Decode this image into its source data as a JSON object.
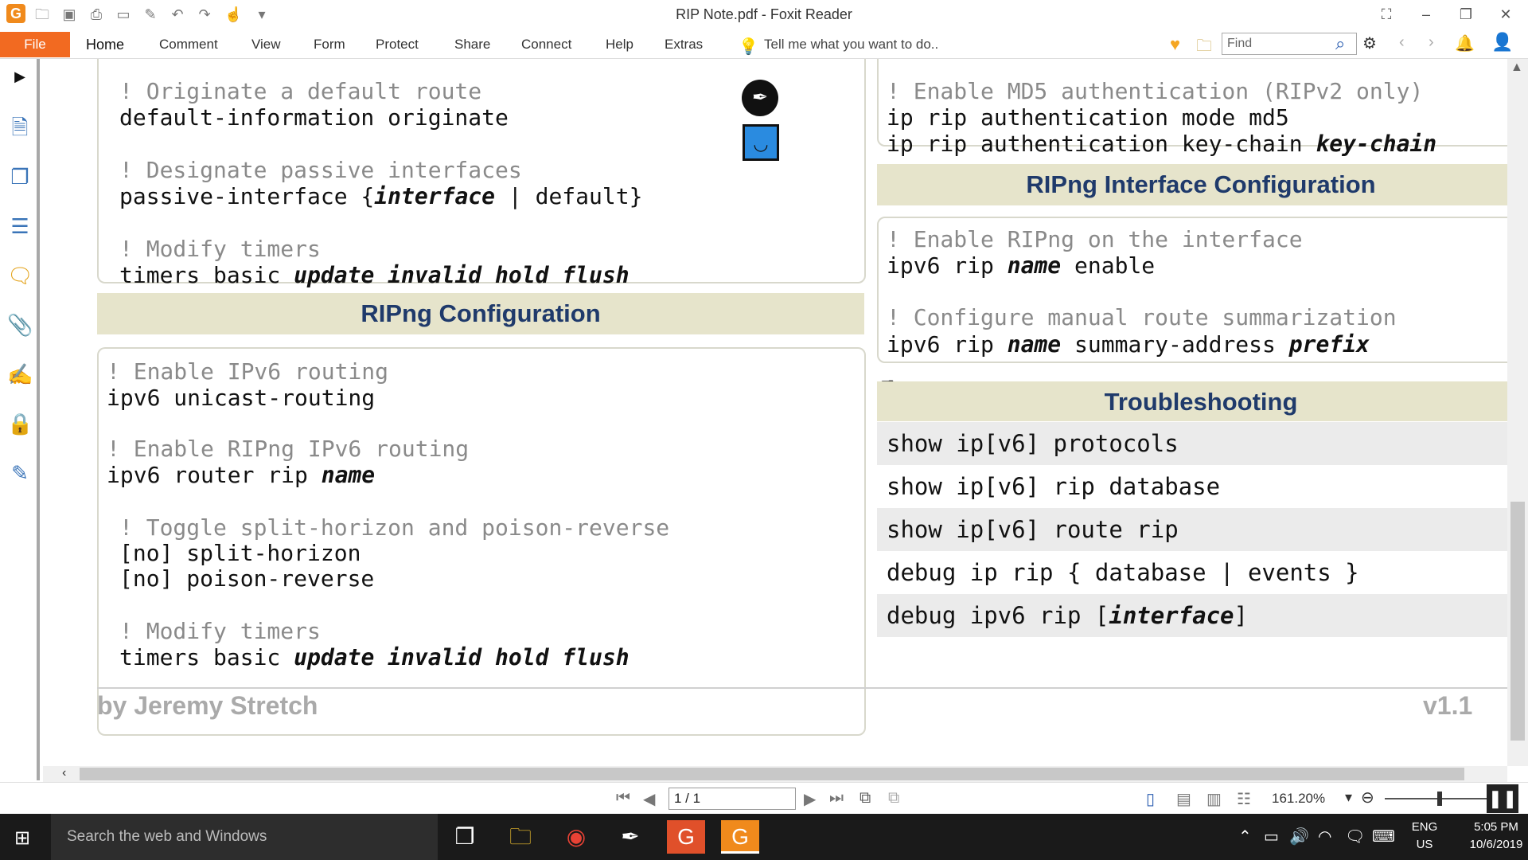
{
  "window": {
    "title": "RIP Note.pdf - Foxit Reader",
    "logo": "G"
  },
  "ribbon": {
    "file": "File",
    "tabs": [
      "Home",
      "Comment",
      "View",
      "Form",
      "Protect",
      "Share",
      "Connect",
      "Help",
      "Extras"
    ],
    "tell_me": "Tell me what you want to do..",
    "find_placeholder": "Find"
  },
  "doc": {
    "left_top": {
      "c1": "! Originate a default route",
      "l1": "default-information originate",
      "c2": "! Designate passive interfaces",
      "l2a": "passive-interface {",
      "l2b": "interface",
      "l2c": " | default}",
      "c3": "! Modify timers",
      "l3a": "timers basic ",
      "l3b": "update invalid hold flush"
    },
    "right_top": {
      "c1": "! Enable MD5 authentication (RIPv2 only)",
      "l1": "ip rip authentication mode md5",
      "l2a": "ip rip authentication key-chain ",
      "l2b": "key-chain"
    },
    "ripng_config": {
      "header": "RIPng Configuration",
      "c1": "! Enable IPv6 routing",
      "l1": "ipv6 unicast-routing",
      "c2": "! Enable RIPng IPv6 routing",
      "l2a": "ipv6 router rip ",
      "l2b": "name",
      "c3": "! Toggle split-horizon and poison-reverse",
      "l3": "[no] split-horizon",
      "l4": "[no] poison-reverse",
      "c4": "! Modify timers",
      "l5a": "timers basic ",
      "l5b": "update invalid hold flush"
    },
    "ripng_iface": {
      "header": "RIPng Interface Configuration",
      "c1": "! Enable RIPng on the interface",
      "l1a": "ipv6 rip ",
      "l1b": "name",
      "l1c": " enable",
      "c2": "! Configure manual route summarization",
      "l2a": "ipv6 rip ",
      "l2b": "name",
      "l2c": " summary-address ",
      "l2d": "prefix"
    },
    "troubleshooting": {
      "header": "Troubleshooting",
      "r1": "show ip[v6] protocols",
      "r2": "show ip[v6] rip database",
      "r3": "show ip[v6] route rip",
      "r4": "debug ip rip { database | events }",
      "r5a": "debug ipv6 rip [",
      "r5b": "interface",
      "r5c": "]"
    },
    "author": "by Jeremy Stretch",
    "version": "v1.1"
  },
  "status": {
    "page": "1 / 1",
    "zoom": "161.20%"
  },
  "taskbar": {
    "search": "Search the web and Windows",
    "lang1": "ENG",
    "lang2": "US",
    "time": "5:05 PM",
    "date": "10/6/2019"
  },
  "colors": {
    "accent": "#f26a21",
    "header_bg": "#e6e4cb",
    "header_text": "#1f3a6b"
  }
}
